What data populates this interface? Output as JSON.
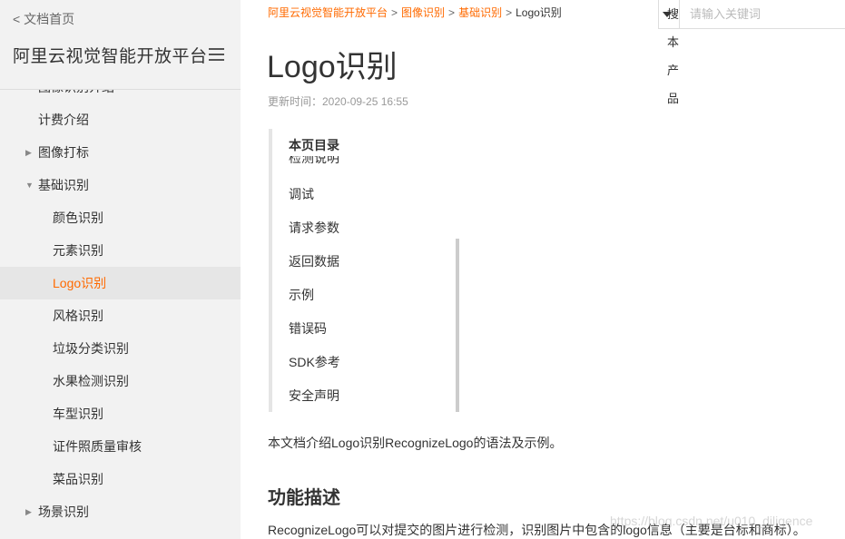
{
  "sidebar": {
    "back_label": "< 文档首页",
    "title": "阿里云视觉智能开放平台",
    "partial_item": "图像识别介绍",
    "items": [
      {
        "label": "计费介绍",
        "level": 1
      },
      {
        "label": "图像打标",
        "level": 1,
        "caret": "▶"
      },
      {
        "label": "基础识别",
        "level": 1,
        "caret": "▼"
      },
      {
        "label": "颜色识别",
        "level": 2
      },
      {
        "label": "元素识别",
        "level": 2
      },
      {
        "label": "Logo识别",
        "level": 2,
        "active": true
      },
      {
        "label": "风格识别",
        "level": 2
      },
      {
        "label": "垃圾分类识别",
        "level": 2
      },
      {
        "label": "水果检测识别",
        "level": 2
      },
      {
        "label": "车型识别",
        "level": 2
      },
      {
        "label": "证件照质量审核",
        "level": 2
      },
      {
        "label": "菜品识别",
        "level": 2
      },
      {
        "label": "场景识别",
        "level": 1,
        "caret": "▶"
      }
    ]
  },
  "breadcrumb": [
    "阿里云视觉智能开放平台",
    "图像识别",
    "基础识别",
    "Logo识别"
  ],
  "search": {
    "select_label": "搜本产品",
    "placeholder": "请输入关键词"
  },
  "page": {
    "title": "Logo识别",
    "updated": "更新时间：2020-09-25 16:55",
    "intro": "本文档介绍Logo识别RecognizeLogo的语法及示例。",
    "section_title": "功能描述",
    "description": "RecognizeLogo可以对提交的图片进行检测，识别图片中包含的logo信息（主要是台标和商标）。"
  },
  "toc": {
    "title": "本页目录",
    "partial_item": "检测说明",
    "items": [
      "调试",
      "请求参数",
      "返回数据",
      "示例",
      "错误码",
      "SDK参考",
      "安全声明"
    ]
  },
  "watermark": "https://blog.csdn.net/u010_diligence",
  "colors": {
    "accent": "#ff6a00",
    "sidebar_bg": "#f2f2f2",
    "active_bg": "#e6e6e6"
  }
}
